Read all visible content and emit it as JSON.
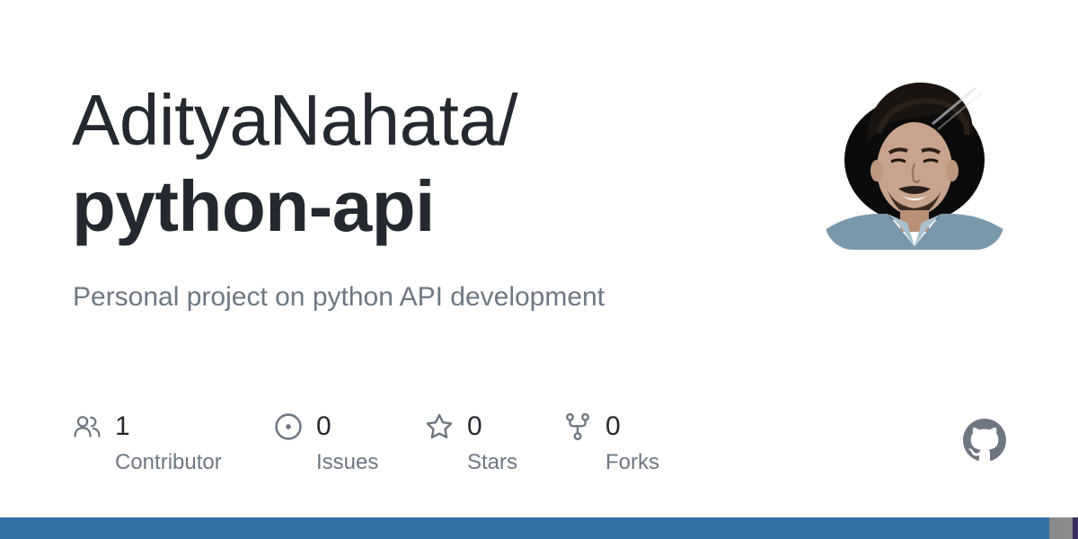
{
  "repo": {
    "owner": "AdityaNahata/",
    "name": "python-api",
    "description": "Personal project on python API development"
  },
  "stats": [
    {
      "icon": "people-icon",
      "count": "1",
      "label": "Contributor"
    },
    {
      "icon": "issue-circle-icon",
      "count": "0",
      "label": "Issues"
    },
    {
      "icon": "star-icon",
      "count": "0",
      "label": "Stars"
    },
    {
      "icon": "repo-forked-icon",
      "count": "0",
      "label": "Forks"
    }
  ],
  "language_bar": [
    {
      "color": "#3572A5",
      "share": 0.973
    },
    {
      "color": "#89898b",
      "share": 0.022
    },
    {
      "color": "#3b2d5c",
      "share": 0.005
    }
  ],
  "colors": {
    "title": "#24292f",
    "muted": "#6e7781",
    "github_mark": "#6e7781"
  }
}
